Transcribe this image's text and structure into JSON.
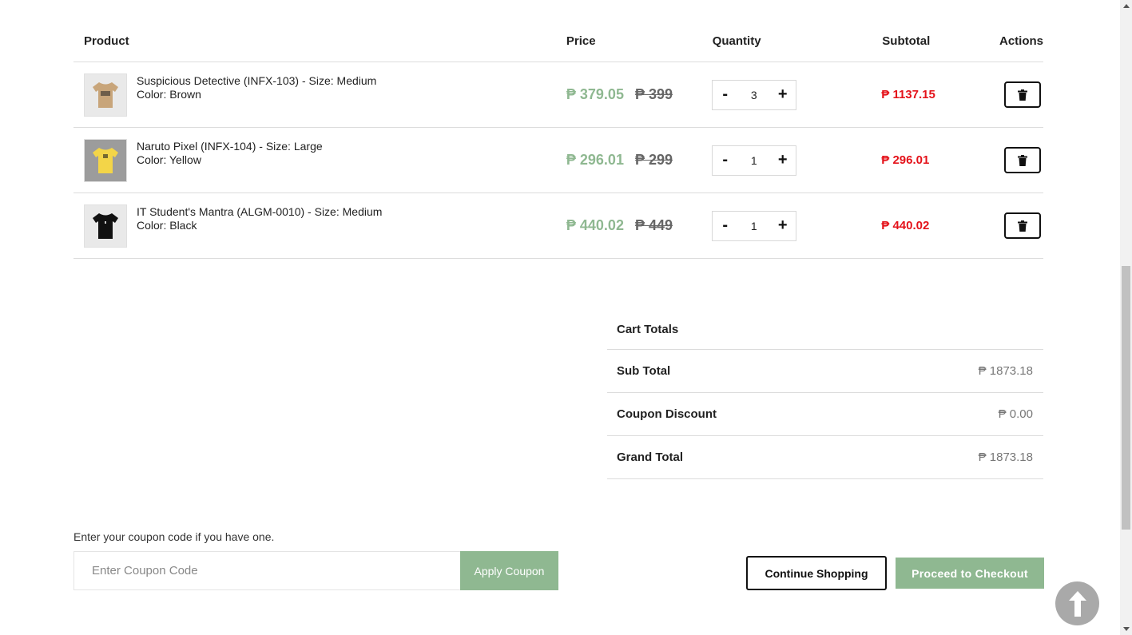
{
  "table": {
    "headers": {
      "product": "Product",
      "price": "Price",
      "quantity": "Quantity",
      "subtotal": "Subtotal",
      "actions": "Actions"
    },
    "rows": [
      {
        "name": "Suspicious Detective (INFX-103) - Size: Medium",
        "color": "Color: Brown",
        "thumb_color": "#c8a57a",
        "price": "₱ 379.05",
        "old_price": "₱ 399",
        "qty": "3",
        "subtotal": "₱ 1137.15"
      },
      {
        "name": "Naruto Pixel (INFX-104) - Size: Large",
        "color": "Color: Yellow",
        "thumb_color": "#f3d548",
        "price": "₱ 296.01",
        "old_price": "₱ 299",
        "qty": "1",
        "subtotal": "₱ 296.01"
      },
      {
        "name": "IT Student's Mantra (ALGM-0010) - Size: Medium",
        "color": "Color: Black",
        "thumb_color": "#111111",
        "price": "₱ 440.02",
        "old_price": "₱ 449",
        "qty": "1",
        "subtotal": "₱ 440.02"
      }
    ],
    "minus_label": "-",
    "plus_label": "+"
  },
  "totals": {
    "title": "Cart Totals",
    "sub_total_label": "Sub Total",
    "sub_total": "₱ 1873.18",
    "discount_label": "Coupon Discount",
    "discount": "₱ 0.00",
    "grand_total_label": "Grand Total",
    "grand_total": "₱ 1873.18"
  },
  "coupon": {
    "label": "Enter your coupon code if you have one.",
    "placeholder": "Enter Coupon Code",
    "button": "Apply Coupon"
  },
  "actions": {
    "continue": "Continue Shopping",
    "checkout": "Proceed to Checkout"
  },
  "colors": {
    "accent": "#8fb891",
    "subtotal": "#e4121a"
  }
}
